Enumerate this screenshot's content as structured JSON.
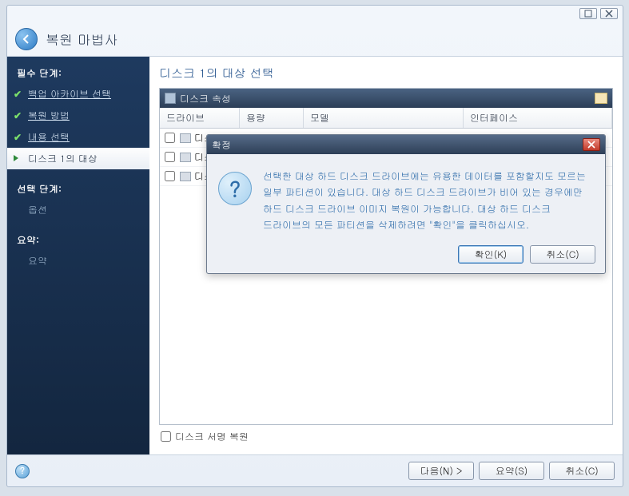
{
  "titlebar": {
    "title": "복원 마법사"
  },
  "sidebar": {
    "required_title": "필수 단계:",
    "optional_title": "선택 단계:",
    "summary_title": "요약:",
    "items": [
      {
        "label": "백업 아카이브 선택",
        "done": true
      },
      {
        "label": "복원 방법",
        "done": true
      },
      {
        "label": "내용 선택",
        "done": true
      },
      {
        "label": "디스크 1의 대상",
        "active": true
      }
    ],
    "optional_items": [
      {
        "label": "옵션"
      }
    ],
    "summary_items": [
      {
        "label": "요약"
      }
    ]
  },
  "main": {
    "title": "디스크 1의 대상 선택",
    "panel_title": "디스크 속성",
    "columns": {
      "drive": "드라이브",
      "capacity": "용량",
      "model": "모델",
      "interface": "인터페이스"
    },
    "rows": [
      {
        "label": "디스"
      },
      {
        "label": "디스"
      },
      {
        "label": "디스"
      }
    ],
    "disk_signature_restore": "디스크 서명 복원"
  },
  "footer": {
    "next": "다음(N) >",
    "summary": "요약(S)",
    "cancel": "취소(C)"
  },
  "modal": {
    "title": "확정",
    "message": "선택한 대상 하드 디스크 드라이브에는 유용한 데이터를 포함할지도 모르는 일부 파티션이 있습니다. 대상 하드 디스크 드라이브가 비어 있는 경우에만 하드 디스크 드라이브 이미지 복원이 가능합니다. 대상 하드 디스크 드라이브의 모든 파티션을 삭제하려면 \"확인\"을 클릭하십시오.",
    "ok": "확인(K)",
    "cancel": "취소(C)"
  }
}
